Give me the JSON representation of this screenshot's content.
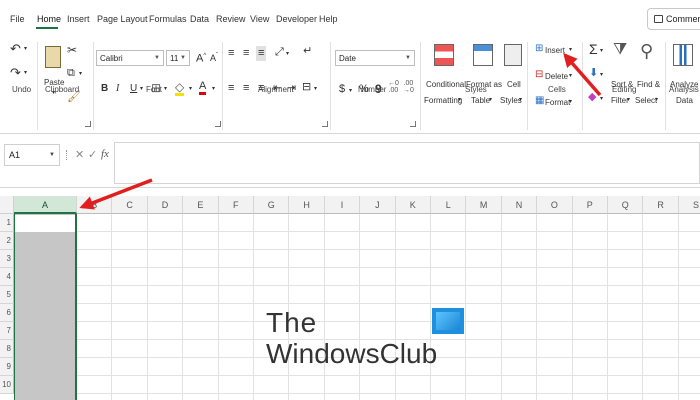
{
  "menu": {
    "items": [
      "File",
      "Home",
      "Insert",
      "Page Layout",
      "Formulas",
      "Data",
      "Review",
      "View",
      "Developer",
      "Help"
    ],
    "active": "Home",
    "comments_label": "Comments"
  },
  "ribbon": {
    "groups": {
      "undo": "Undo",
      "clipboard": "Clipboard",
      "font": "Font",
      "alignment": "Alignment",
      "number": "Number",
      "styles": "Styles",
      "cells": "Cells",
      "editing": "Editing",
      "analysis": "Analysis"
    },
    "paste_label": "Paste",
    "font_name": "Calibri",
    "font_size": "11",
    "number_format": "Date",
    "styles": {
      "conditional_1": "Conditional",
      "conditional_2": "Formatting",
      "format_table_1": "Format as",
      "format_table_2": "Table",
      "cell_styles_1": "Cell",
      "cell_styles_2": "Styles"
    },
    "cells": {
      "insert": "Insert",
      "delete": "Delete",
      "format": "Format"
    },
    "editing": {
      "sort_1": "Sort &",
      "sort_2": "Filter",
      "find_1": "Find &",
      "find_2": "Select"
    },
    "analysis": {
      "analyze_1": "Analyze",
      "analyze_2": "Data"
    },
    "symbols": {
      "bold": "B",
      "italic": "I",
      "underline": "U",
      "currency": "$",
      "percent": "%",
      "comma": "9",
      "sum": "Σ"
    }
  },
  "formula_bar": {
    "name_box": "A1",
    "fx": "fx",
    "cancel": "✕",
    "enter": "✓",
    "content": ""
  },
  "grid": {
    "columns": [
      "A",
      "B",
      "C",
      "D",
      "E",
      "F",
      "G",
      "H",
      "I",
      "J",
      "K",
      "L",
      "M",
      "N",
      "O",
      "P",
      "Q",
      "R",
      "S"
    ],
    "rows": [
      "1",
      "2",
      "3",
      "4",
      "5",
      "6",
      "7",
      "8",
      "9",
      "10"
    ],
    "selected_column": "A"
  },
  "watermark": {
    "line1": "The",
    "line2": "WindowsClub"
  },
  "colors": {
    "excel_green": "#217346",
    "arrow_red": "#e02020",
    "selection_gray": "#c6c6c6"
  }
}
